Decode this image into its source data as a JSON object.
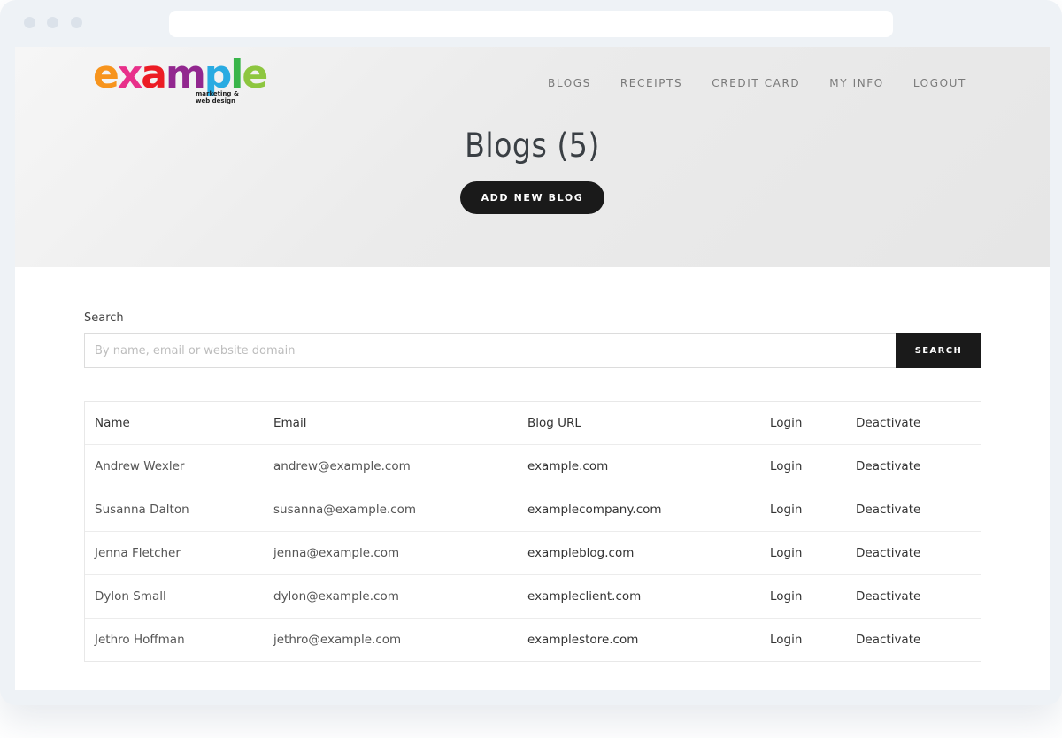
{
  "logo": {
    "letters": [
      {
        "char": "e",
        "color": "#f7941d"
      },
      {
        "char": "x",
        "color": "#e8308a"
      },
      {
        "char": "a",
        "color": "#ec1c24"
      },
      {
        "char": "m",
        "color": "#92278f"
      },
      {
        "char": "p",
        "color": "#29abe2"
      },
      {
        "char": "l",
        "color": "#39b54a"
      },
      {
        "char": "e",
        "color": "#8dc63f"
      }
    ],
    "tagline_line1": "marketing &",
    "tagline_line2": "web design"
  },
  "nav": {
    "items": [
      {
        "label": "BLOGS"
      },
      {
        "label": "RECEIPTS"
      },
      {
        "label": "CREDIT CARD"
      },
      {
        "label": "MY INFO"
      },
      {
        "label": "LOGOUT"
      }
    ]
  },
  "header": {
    "title": "Blogs (5)",
    "add_button_label": "ADD NEW BLOG"
  },
  "search": {
    "label": "Search",
    "placeholder": "By name, email or website domain",
    "value": "",
    "button_label": "SEARCH"
  },
  "table": {
    "columns": [
      "Name",
      "Email",
      "Blog URL",
      "Login",
      "Deactivate"
    ],
    "rows": [
      {
        "name": "Andrew Wexler",
        "email": "andrew@example.com",
        "url": "example.com",
        "login": "Login",
        "deactivate": "Deactivate"
      },
      {
        "name": "Susanna Dalton",
        "email": "susanna@example.com",
        "url": "examplecompany.com",
        "login": "Login",
        "deactivate": "Deactivate"
      },
      {
        "name": "Jenna Fletcher",
        "email": "jenna@example.com",
        "url": "exampleblog.com",
        "login": "Login",
        "deactivate": "Deactivate"
      },
      {
        "name": "Dylon Small",
        "email": "dylon@example.com",
        "url": "exampleclient.com",
        "login": "Login",
        "deactivate": "Deactivate"
      },
      {
        "name": "Jethro Hoffman",
        "email": "jethro@example.com",
        "url": "examplestore.com",
        "login": "Login",
        "deactivate": "Deactivate"
      }
    ]
  },
  "colors": {
    "dark_button": "#1a1a1a",
    "hero_bg": "#ebebeb",
    "nav_text": "#7a7a7a"
  }
}
